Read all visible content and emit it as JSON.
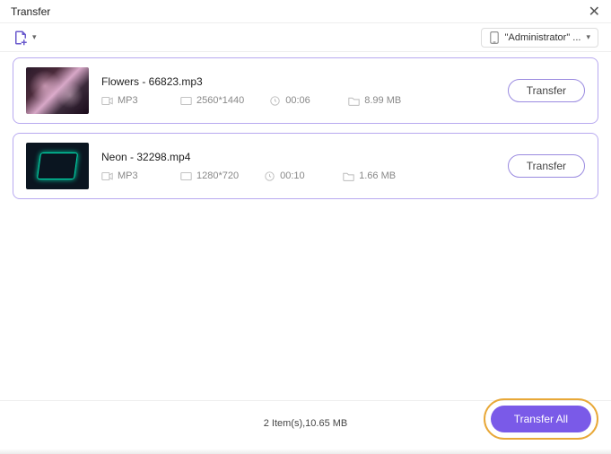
{
  "window": {
    "title": "Transfer"
  },
  "toolbar": {
    "device_label": "\"Administrator\" ..."
  },
  "files": [
    {
      "name": "Flowers - 66823.mp3",
      "format": "MP3",
      "resolution": "2560*1440",
      "duration": "00:06",
      "size": "8.99 MB",
      "transfer_label": "Transfer"
    },
    {
      "name": "Neon - 32298.mp4",
      "format": "MP3",
      "resolution": "1280*720",
      "duration": "00:10",
      "size": "1.66 MB",
      "transfer_label": "Transfer"
    }
  ],
  "footer": {
    "summary": "2 Item(s),10.65 MB",
    "transfer_all_label": "Transfer All"
  }
}
